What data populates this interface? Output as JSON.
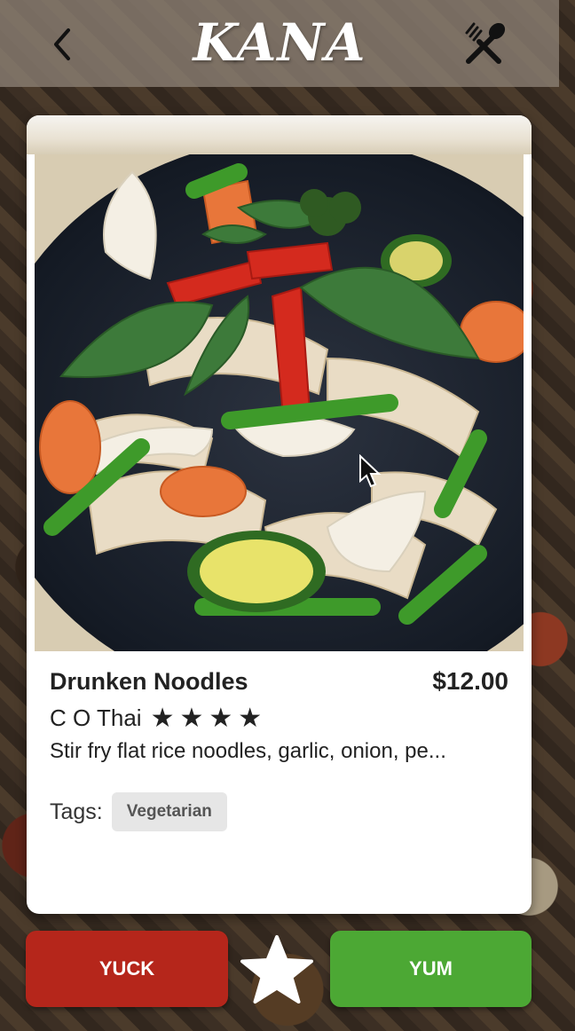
{
  "header": {
    "logo": "KANA",
    "back_icon": "chevron-left-icon",
    "menu_icon": "fork-spoon-icon"
  },
  "dish": {
    "name": "Drunken Noodles",
    "price": "$12.00",
    "restaurant": "C O Thai",
    "rating": 4,
    "stars": [
      "★",
      "★",
      "★",
      "★"
    ],
    "description": "Stir fry flat rice noodles, garlic, onion, pe...",
    "tags_label": "Tags:",
    "tags": [
      "Vegetarian"
    ]
  },
  "actions": {
    "yuck_label": "YUCK",
    "yum_label": "YUM",
    "favorite_icon": "star-icon"
  },
  "colors": {
    "yuck": "#b5261b",
    "yum": "#4ca834",
    "header_bg": "#8c8074"
  }
}
